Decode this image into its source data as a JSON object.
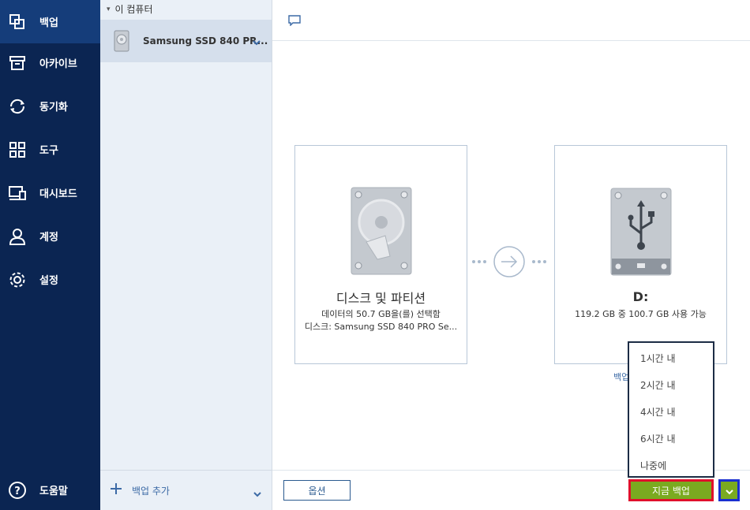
{
  "sidebar": {
    "items": [
      {
        "label": "백업",
        "icon": "copy-icon"
      },
      {
        "label": "아카이브",
        "icon": "archive-icon"
      },
      {
        "label": "동기화",
        "icon": "sync-icon"
      },
      {
        "label": "도구",
        "icon": "grid-icon"
      },
      {
        "label": "대시보드",
        "icon": "dashboard-icon"
      },
      {
        "label": "계정",
        "icon": "user-icon"
      },
      {
        "label": "설정",
        "icon": "gear-icon"
      }
    ],
    "help_label": "도움말"
  },
  "source_panel": {
    "header": "이 컴퓨터",
    "item_label": "Samsung SSD 840 PR...",
    "add_label": "백업 추가"
  },
  "source_card": {
    "title": "디스크 및 파티션",
    "line1": "데이터의 50.7 GB을(를) 선택함",
    "line2": "디스크: Samsung SSD 840 PRO Se..."
  },
  "dest_card": {
    "title": "D:",
    "line1": "119.2 GB 중 100.7 GB 사용 가능"
  },
  "link_peek": "백업",
  "dropdown": {
    "items": [
      "1시간 내",
      "2시간 내",
      "4시간 내",
      "6시간 내",
      "나중에"
    ]
  },
  "bottom": {
    "options_label": "옵션",
    "backup_now_label": "지금 백업"
  },
  "colors": {
    "sidebar": "#0b2552",
    "accent_green": "#7aaa20",
    "highlight_red": "#e0102c",
    "highlight_blue": "#1a2fd0"
  }
}
